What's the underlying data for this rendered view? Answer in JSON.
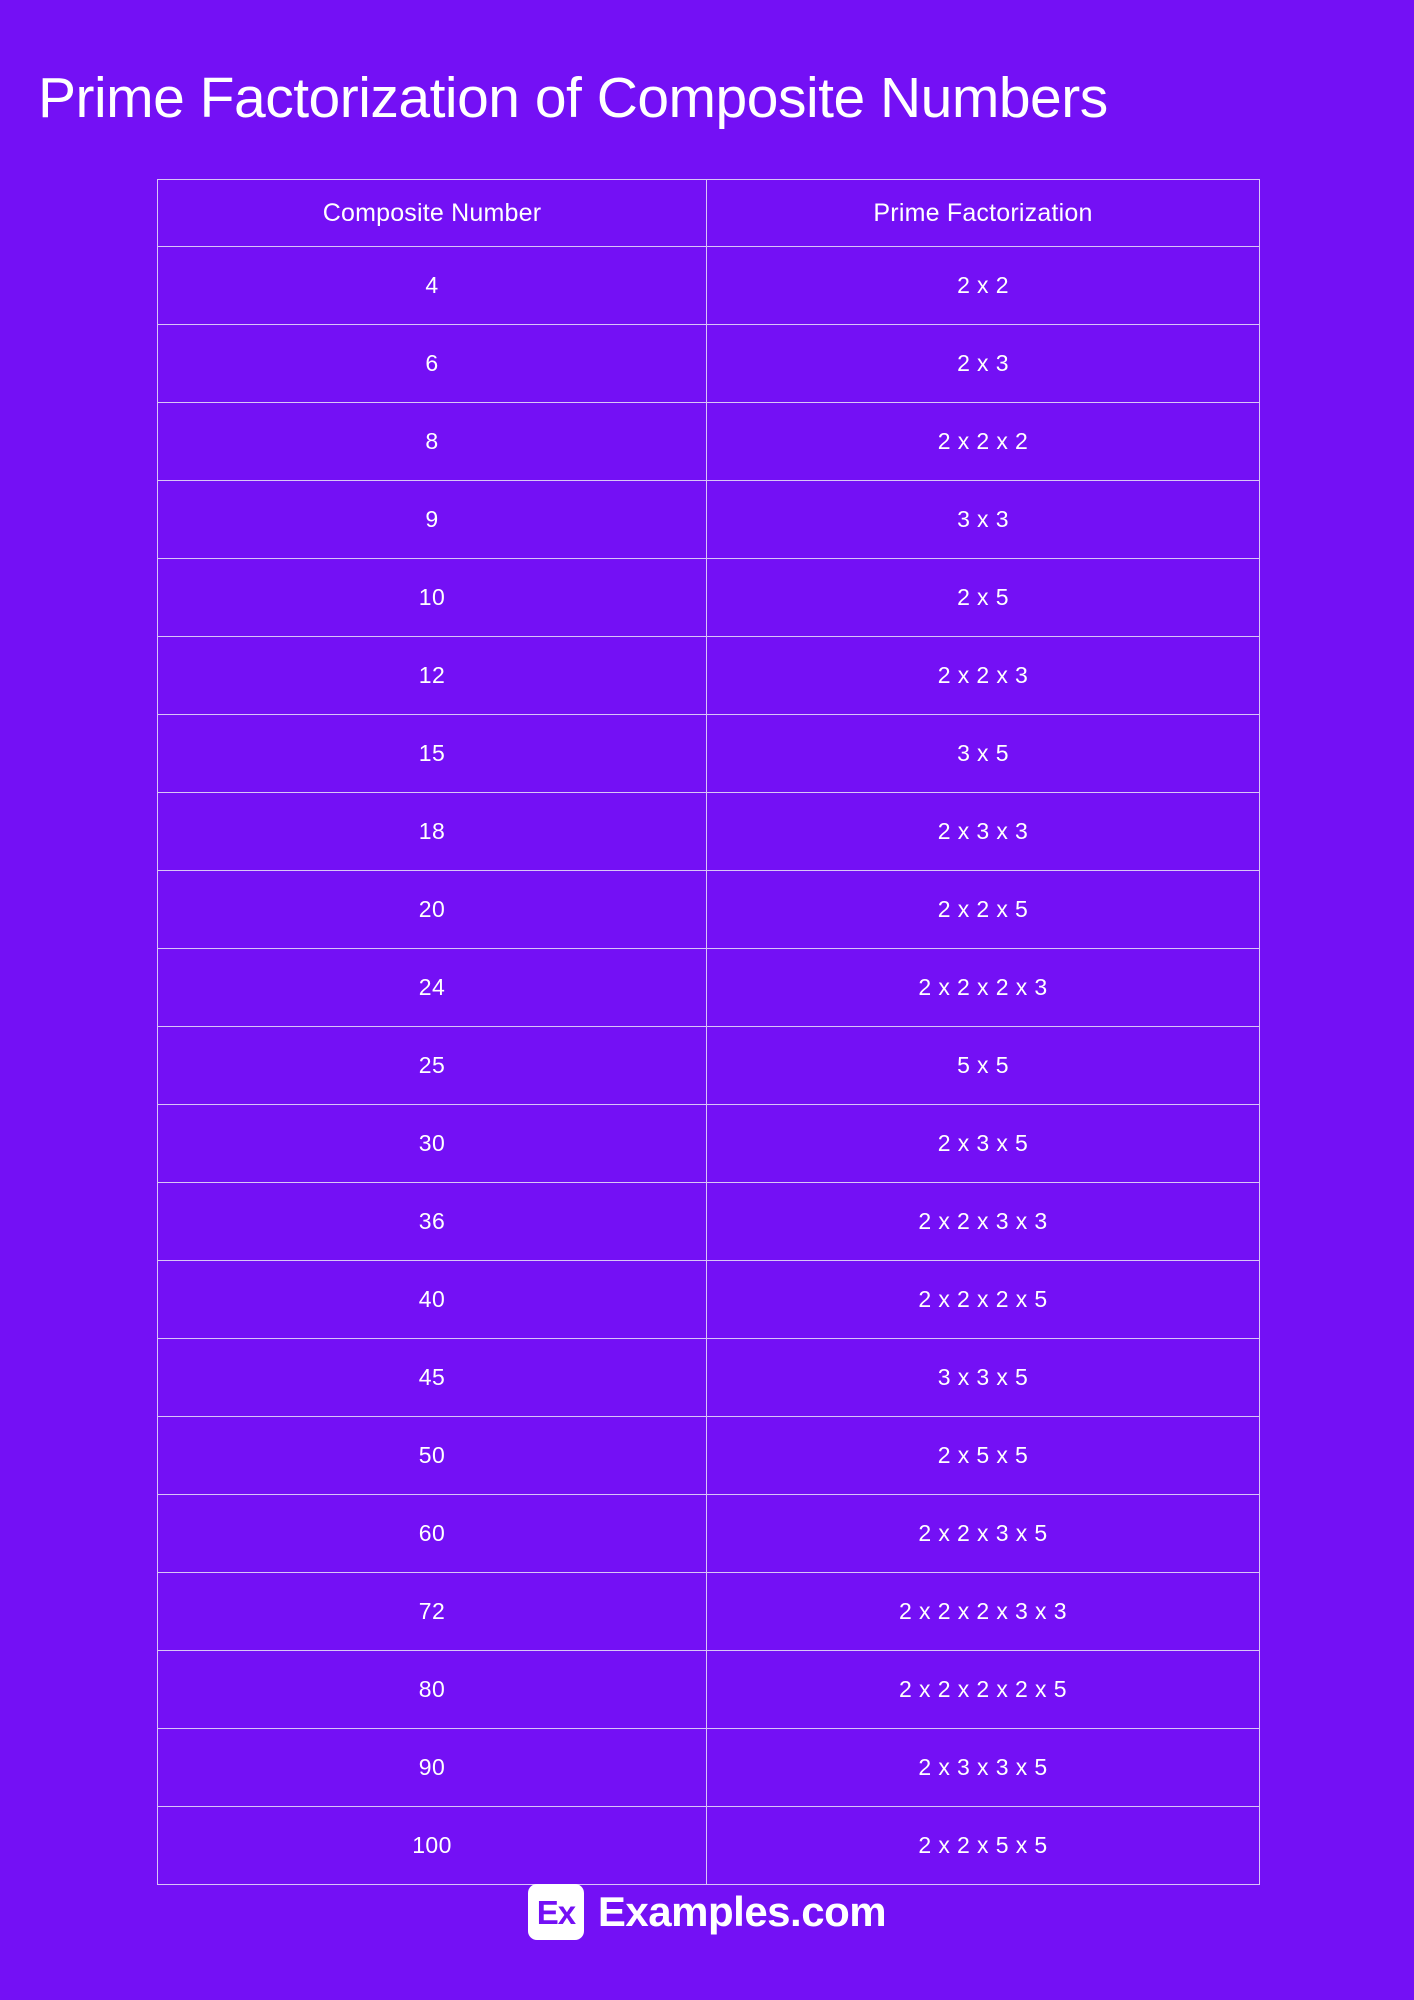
{
  "page": {
    "title": "Prime Factorization of Composite Numbers",
    "background_color": "#7410f5",
    "text_color": "#ffffff",
    "border_color": "#d9c4f7"
  },
  "table": {
    "headers": [
      "Composite Number",
      "Prime Factorization"
    ],
    "rows": [
      {
        "number": "4",
        "factorization": "2 x 2"
      },
      {
        "number": "6",
        "factorization": "2 x 3"
      },
      {
        "number": "8",
        "factorization": "2 x 2 x 2"
      },
      {
        "number": "9",
        "factorization": "3 x 3"
      },
      {
        "number": "10",
        "factorization": "2 x 5"
      },
      {
        "number": "12",
        "factorization": "2 x 2 x 3"
      },
      {
        "number": "15",
        "factorization": "3 x 5"
      },
      {
        "number": "18",
        "factorization": "2 x 3 x 3"
      },
      {
        "number": "20",
        "factorization": "2 x 2 x 5"
      },
      {
        "number": "24",
        "factorization": "2 x 2 x 2 x 3"
      },
      {
        "number": "25",
        "factorization": "5 x 5"
      },
      {
        "number": "30",
        "factorization": "2 x 3 x 5"
      },
      {
        "number": "36",
        "factorization": "2 x 2 x 3 x 3"
      },
      {
        "number": "40",
        "factorization": "2 x 2 x 2 x 5"
      },
      {
        "number": "45",
        "factorization": "3 x 3 x 5"
      },
      {
        "number": "50",
        "factorization": "2 x 5 x 5"
      },
      {
        "number": "60",
        "factorization": "2 x 2 x 3 x 5"
      },
      {
        "number": "72",
        "factorization": "2 x 2 x 2 x 3 x 3"
      },
      {
        "number": "80",
        "factorization": "2 x 2 x 2 x 2 x 5"
      },
      {
        "number": "90",
        "factorization": "2 x 3 x 3 x 5"
      },
      {
        "number": "100",
        "factorization": "2 x 2 x 5 x 5"
      }
    ]
  },
  "footer": {
    "logo_mark_text": "Ex",
    "logo_text": "Examples.com"
  }
}
